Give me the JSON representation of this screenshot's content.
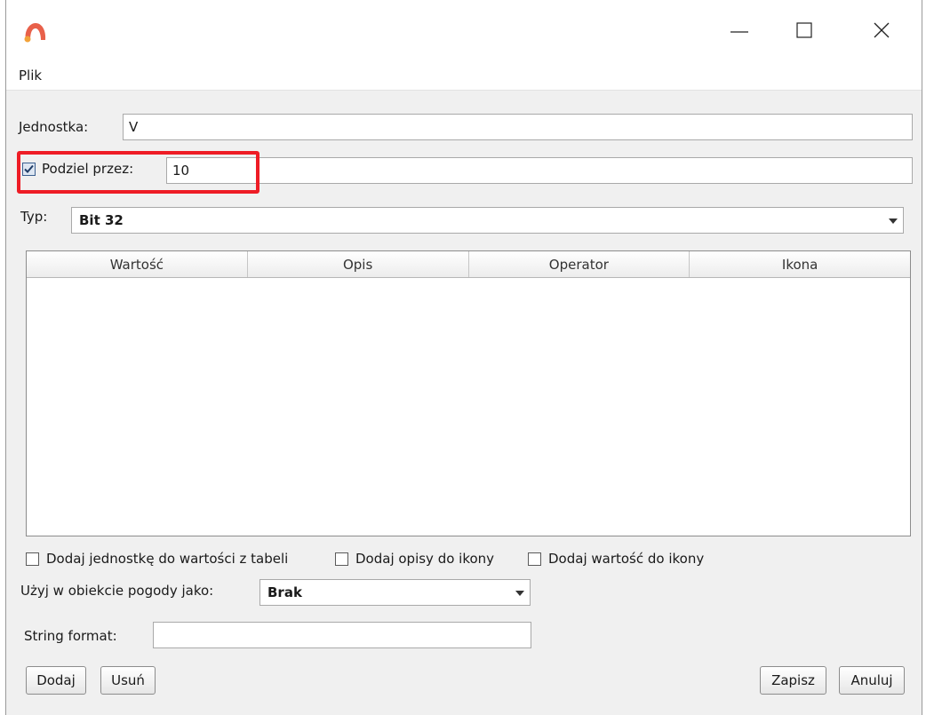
{
  "titlebar": {
    "icon": "app-logo-icon",
    "controls": [
      "minimize-icon",
      "maximize-icon",
      "close-icon"
    ]
  },
  "menu": {
    "items": [
      "Plik"
    ]
  },
  "form": {
    "unit_label": "Jednostka:",
    "unit_value": "V",
    "divide_checkbox_checked": true,
    "divide_label": "Podziel przez:",
    "divide_value": "10",
    "type_label": "Typ:",
    "type_value": "Bit 32"
  },
  "table": {
    "columns": [
      "Wartość",
      "Opis",
      "Operator",
      "Ikona"
    ],
    "rows": []
  },
  "options": {
    "add_unit_label": "Dodaj jednostkę do wartości z tabeli",
    "add_unit_checked": false,
    "add_descriptions_label": "Dodaj opisy do ikony",
    "add_descriptions_checked": false,
    "add_value_label": "Dodaj wartość do ikony",
    "add_value_checked": false
  },
  "weather": {
    "label": "Użyj w obiekcie pogody jako:",
    "value": "Brak"
  },
  "string_format": {
    "label": "String format:",
    "value": ""
  },
  "buttons": {
    "add": "Dodaj",
    "remove": "Usuń",
    "save": "Zapisz",
    "cancel": "Anuluj"
  },
  "colors": {
    "highlight": "#ee1c25",
    "background": "#f0f0f0",
    "app_icon": "#e8604a"
  }
}
